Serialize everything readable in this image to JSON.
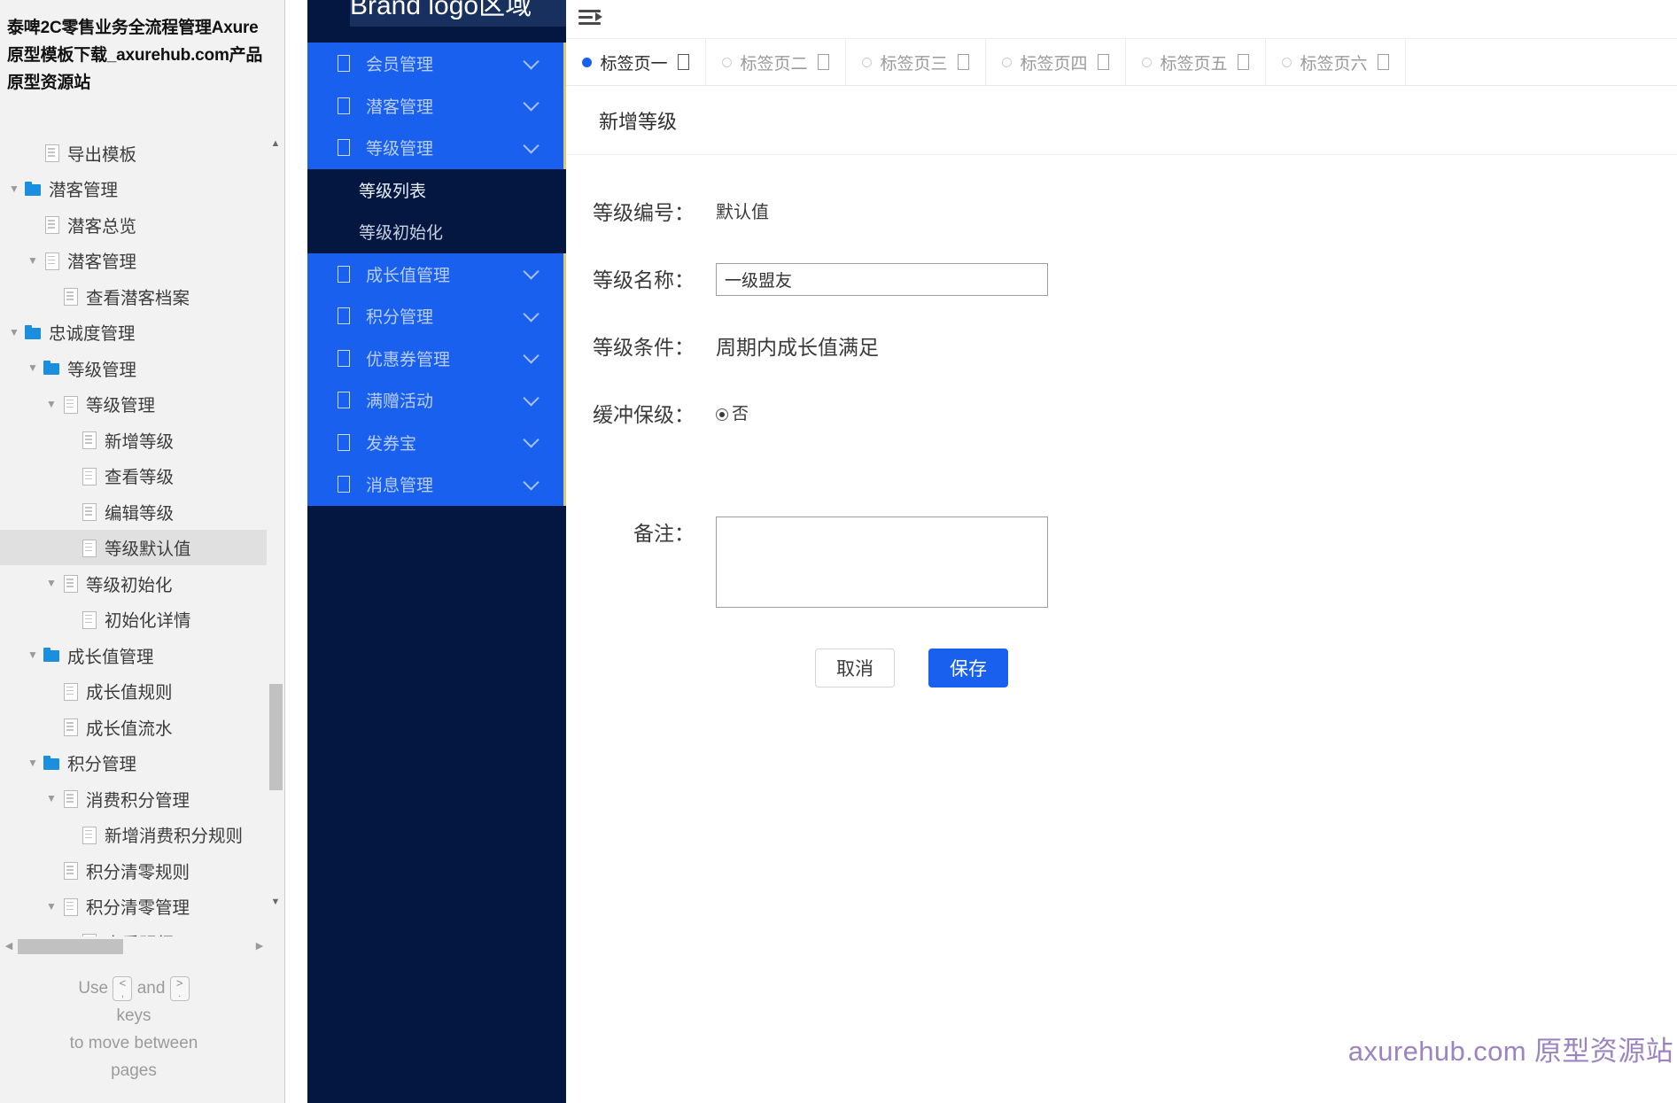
{
  "sitemap": {
    "title": "泰啤2C零售业务全流程管理Axure原型模板下载_axurehub.com产品原型资源站",
    "nodes": [
      {
        "label": "导出模板",
        "icon": "page",
        "depth": 2,
        "caret": "",
        "selected": false
      },
      {
        "label": "潜客管理",
        "icon": "folder",
        "depth": 1,
        "caret": "down",
        "selected": false
      },
      {
        "label": "潜客总览",
        "icon": "page",
        "depth": 2,
        "caret": "",
        "selected": false
      },
      {
        "label": "潜客管理",
        "icon": "page",
        "depth": 2,
        "caret": "down",
        "selected": false
      },
      {
        "label": "查看潜客档案",
        "icon": "page",
        "depth": 3,
        "caret": "",
        "selected": false
      },
      {
        "label": "忠诚度管理",
        "icon": "folder",
        "depth": 1,
        "caret": "down",
        "selected": false
      },
      {
        "label": "等级管理",
        "icon": "folder",
        "depth": 2,
        "caret": "down",
        "selected": false
      },
      {
        "label": "等级管理",
        "icon": "page",
        "depth": 3,
        "caret": "down",
        "selected": false
      },
      {
        "label": "新增等级",
        "icon": "page",
        "depth": 4,
        "caret": "",
        "selected": false
      },
      {
        "label": "查看等级",
        "icon": "page",
        "depth": 4,
        "caret": "",
        "selected": false
      },
      {
        "label": "编辑等级",
        "icon": "page",
        "depth": 4,
        "caret": "",
        "selected": false
      },
      {
        "label": "等级默认值",
        "icon": "page",
        "depth": 4,
        "caret": "",
        "selected": true
      },
      {
        "label": "等级初始化",
        "icon": "page",
        "depth": 3,
        "caret": "down",
        "selected": false
      },
      {
        "label": "初始化详情",
        "icon": "page",
        "depth": 4,
        "caret": "",
        "selected": false
      },
      {
        "label": "成长值管理",
        "icon": "folder",
        "depth": 2,
        "caret": "down",
        "selected": false
      },
      {
        "label": "成长值规则",
        "icon": "page",
        "depth": 3,
        "caret": "",
        "selected": false
      },
      {
        "label": "成长值流水",
        "icon": "page",
        "depth": 3,
        "caret": "",
        "selected": false
      },
      {
        "label": "积分管理",
        "icon": "folder",
        "depth": 2,
        "caret": "down",
        "selected": false
      },
      {
        "label": "消费积分管理",
        "icon": "page",
        "depth": 3,
        "caret": "down",
        "selected": false
      },
      {
        "label": "新增消费积分规则",
        "icon": "page",
        "depth": 4,
        "caret": "",
        "selected": false
      },
      {
        "label": "积分清零规则",
        "icon": "page",
        "depth": 3,
        "caret": "",
        "selected": false
      },
      {
        "label": "积分清零管理",
        "icon": "page",
        "depth": 3,
        "caret": "down",
        "selected": false
      },
      {
        "label": "查看明细",
        "icon": "page",
        "depth": 4,
        "caret": "",
        "selected": false
      }
    ],
    "hint": {
      "use": "Use",
      "key_prev": "<",
      "key_prev_sub": ",",
      "and": "and",
      "key_next": ">",
      "key_next_sub": ".",
      "keys": "keys",
      "line2": "to move between",
      "line3": "pages"
    }
  },
  "nav": {
    "brand": "Brand logo区域",
    "items": [
      {
        "label": "会员管理",
        "expanded": false
      },
      {
        "label": "潜客管理",
        "expanded": false
      },
      {
        "label": "等级管理",
        "expanded": true
      },
      {
        "label": "成长值管理",
        "expanded": false
      },
      {
        "label": "积分管理",
        "expanded": false
      },
      {
        "label": "优惠券管理",
        "expanded": false
      },
      {
        "label": "满赠活动",
        "expanded": false
      },
      {
        "label": "发券宝",
        "expanded": false
      },
      {
        "label": "消息管理",
        "expanded": false
      }
    ],
    "submenu": [
      {
        "label": "等级列表",
        "active": true
      },
      {
        "label": "等级初始化",
        "active": false
      }
    ]
  },
  "topbar": {
    "fold_icon": "menu-fold-icon"
  },
  "tabs": [
    {
      "label": "标签页一",
      "active": true
    },
    {
      "label": "标签页二",
      "active": false
    },
    {
      "label": "标签页三",
      "active": false
    },
    {
      "label": "标签页四",
      "active": false
    },
    {
      "label": "标签页五",
      "active": false
    },
    {
      "label": "标签页六",
      "active": false
    }
  ],
  "panel": {
    "title": "新增等级",
    "fields": {
      "code_label": "等级编号：",
      "code_value": "默认值",
      "name_label": "等级名称：",
      "name_value": "一级盟友",
      "cond_label": "等级条件：",
      "cond_value": "周期内成长值满足",
      "buffer_label": "缓冲保级：",
      "buffer_option": "否",
      "remark_label": "备注：",
      "remark_value": ""
    },
    "buttons": {
      "cancel": "取消",
      "save": "保存"
    }
  },
  "watermark": "axurehub.com 原型资源站",
  "colors": {
    "nav_bg_dark": "#041740",
    "nav_item_blue": "#1960ee",
    "nav_accent_gold": "#d8c87a",
    "primary": "#1960ee",
    "watermark": "#9c84c0",
    "tree_selected": "#e0e0e0"
  }
}
